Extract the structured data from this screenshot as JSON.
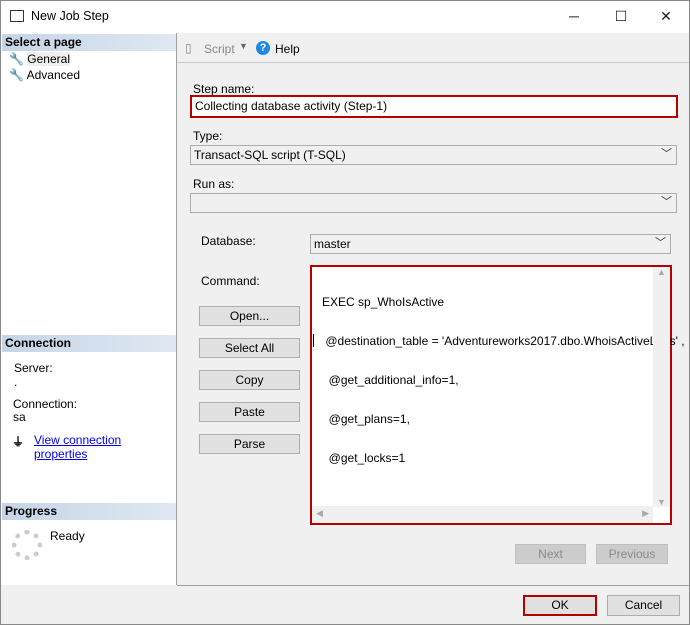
{
  "window": {
    "title": "New Job Step",
    "minimize": "─",
    "maximize": "☐",
    "close": "✕"
  },
  "sidebar": {
    "select_page": "Select a page",
    "pages": [
      {
        "label": "General"
      },
      {
        "label": "Advanced"
      }
    ],
    "connection": {
      "header": "Connection",
      "server_label": "Server:",
      "server_value": ".",
      "connection_label": "Connection:",
      "connection_value": "sa",
      "view_link": "View connection properties"
    },
    "progress": {
      "header": "Progress",
      "status": "Ready"
    }
  },
  "toolbar": {
    "script": "Script",
    "help": "Help"
  },
  "form": {
    "step_name_label": "Step name:",
    "step_name": "Collecting database activity (Step-1)",
    "type_label": "Type:",
    "type_value": "Transact-SQL script (T-SQL)",
    "run_as_label": "Run as:",
    "run_as_value": "",
    "database_label": "Database:",
    "database_value": "master",
    "command_label": "Command:",
    "command_lines": [
      "EXEC sp_WhoIsActive",
      " @destination_table = 'Adventureworks2017.dbo.WhoisActiveLogs' ,",
      "  @get_additional_info=1,",
      "  @get_plans=1,",
      "  @get_locks=1"
    ],
    "buttons": {
      "open": "Open...",
      "select_all": "Select All",
      "copy": "Copy",
      "paste": "Paste",
      "parse": "Parse"
    }
  },
  "nav": {
    "next": "Next",
    "previous": "Previous"
  },
  "footer": {
    "ok": "OK",
    "cancel": "Cancel"
  },
  "colors": {
    "highlight": "#b40000",
    "link": "#0000ee",
    "section_header": "#c5d5e6"
  }
}
